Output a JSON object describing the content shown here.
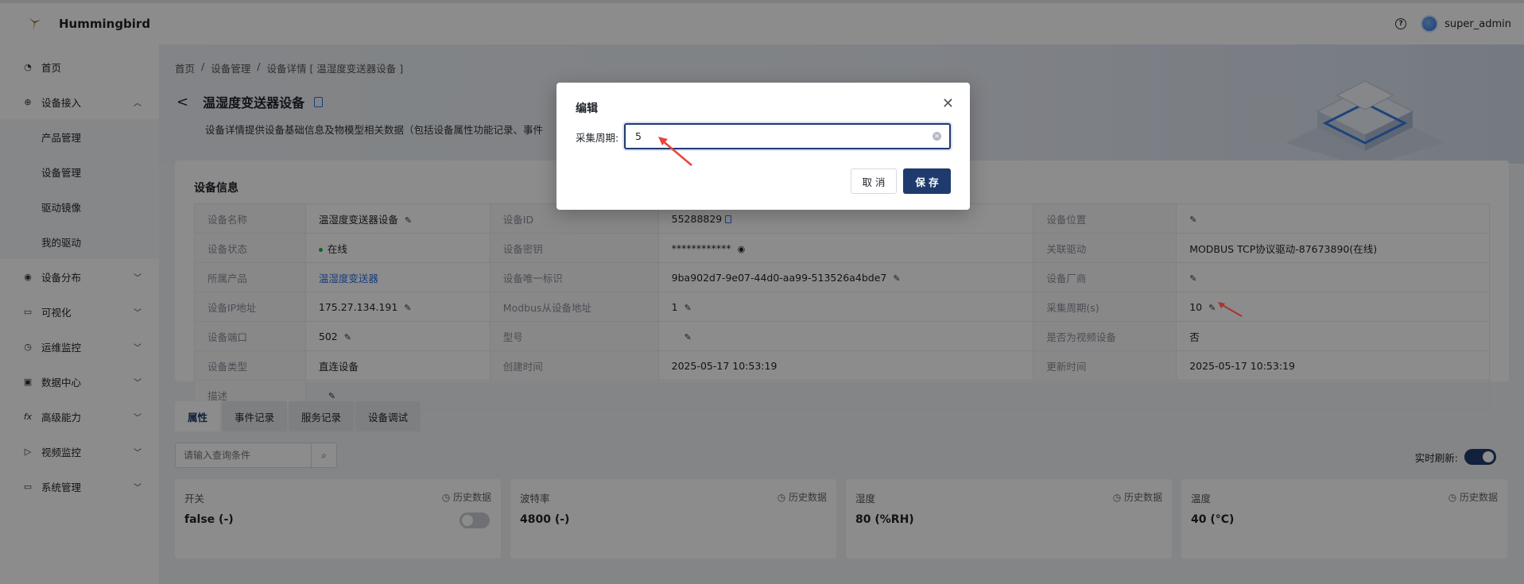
{
  "app": {
    "title": "Hummingbird"
  },
  "header": {
    "help_icon": "question-circle-icon",
    "user_name": "super_admin"
  },
  "sidebar": {
    "items": [
      {
        "label": "首页",
        "icon": "dashboard-icon"
      },
      {
        "label": "设备接入",
        "icon": "globe-icon",
        "expanded": true,
        "children": [
          {
            "label": "产品管理"
          },
          {
            "label": "设备管理"
          },
          {
            "label": "驱动镜像"
          },
          {
            "label": "我的驱动"
          }
        ]
      },
      {
        "label": "设备分布",
        "icon": "eye-icon"
      },
      {
        "label": "可视化",
        "icon": "monitor-icon"
      },
      {
        "label": "运维监控",
        "icon": "clock-icon"
      },
      {
        "label": "数据中心",
        "icon": "screen-icon"
      },
      {
        "label": "高级能力",
        "icon": "fx-icon"
      },
      {
        "label": "视频监控",
        "icon": "camera-icon"
      },
      {
        "label": "系统管理",
        "icon": "monitor-icon"
      }
    ]
  },
  "breadcrumb": [
    "首页",
    "/",
    "设备管理",
    "/",
    "设备详情 [ 温湿度变送器设备 ]"
  ],
  "page": {
    "title": "温湿度变送器设备",
    "description": "设备详情提供设备基础信息及物模型相关数据（包括设备属性功能记录、事件"
  },
  "device_info": {
    "title": "设备信息",
    "rows": [
      [
        "设备名称",
        "温湿度变送器设备",
        "设备ID",
        "55288829",
        "设备位置",
        ""
      ],
      [
        "设备状态",
        "在线",
        "设备密钥",
        "************",
        "关联驱动",
        "MODBUS TCP协议驱动-87673890(在线)"
      ],
      [
        "所属产品",
        "温湿度变送器",
        "设备唯一标识",
        "9ba902d7-9e07-44d0-aa99-513526a4bde7",
        "设备厂商",
        ""
      ],
      [
        "设备IP地址",
        "175.27.134.191",
        "Modbus从设备地址",
        "1",
        "采集周期(s)",
        "10"
      ],
      [
        "设备端口",
        "502",
        "型号",
        "",
        "是否为视频设备",
        "否"
      ],
      [
        "设备类型",
        "直连设备",
        "创建时间",
        "2025-05-17 10:53:19",
        "更新时间",
        "2025-05-17 10:53:19"
      ],
      [
        "描述",
        ""
      ]
    ]
  },
  "tabs": [
    "属性",
    "事件记录",
    "服务记录",
    "设备调试"
  ],
  "properties_panel": {
    "search_placeholder": "请输入查询条件",
    "realtime_label": "实时刷新:",
    "realtime_on": true,
    "history_label": "历史数据",
    "cards": [
      {
        "name": "开关",
        "value": "false (-)"
      },
      {
        "name": "波特率",
        "value": "4800 (-)"
      },
      {
        "name": "湿度",
        "value": "80 (%RH)"
      },
      {
        "name": "温度",
        "value": "40 (°C)"
      }
    ]
  },
  "modal": {
    "title": "编辑",
    "field_label": "采集周期:",
    "field_value": "5",
    "cancel_label": "取 消",
    "save_label": "保 存"
  },
  "colors": {
    "primary": "#1f3b6e",
    "link": "#2f6fe4",
    "online": "#27b148",
    "annotation": "#e8453c"
  }
}
